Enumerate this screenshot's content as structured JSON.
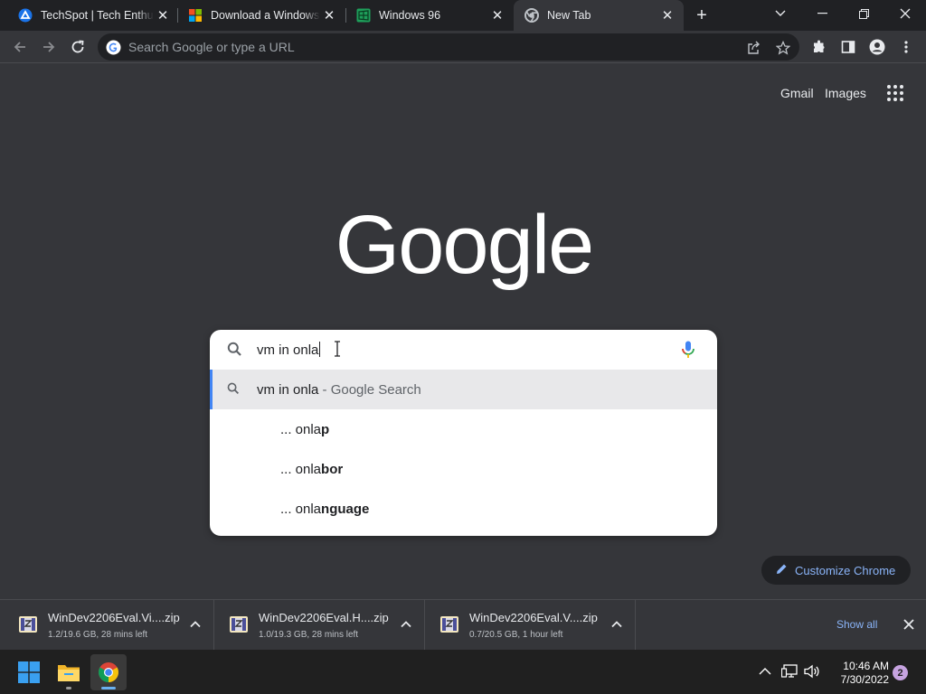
{
  "browser": {
    "tabs": [
      {
        "title": "TechSpot | Tech Enthusiasts, Power Users, Gamers",
        "favicon": "techspot-icon"
      },
      {
        "title": "Download a Windows virtual machine",
        "favicon": "microsoft-icon"
      },
      {
        "title": "Windows 96",
        "favicon": "windows96-icon"
      },
      {
        "title": "New Tab",
        "favicon": "chrome-icon",
        "active": true
      }
    ],
    "omnibox": {
      "placeholder": "Search Google or type a URL"
    }
  },
  "ntp": {
    "links": {
      "gmail": "Gmail",
      "images": "Images"
    },
    "search": {
      "query": "vm in onla",
      "suggestions": [
        {
          "primary": "vm in onla",
          "suffix": " - Google Search",
          "type": "search"
        },
        {
          "prefix": "... onla",
          "completion": "p"
        },
        {
          "prefix": "... onla",
          "completion": "bor"
        },
        {
          "prefix": "... onla",
          "completion": "nguage"
        }
      ]
    },
    "customize_label": "Customize Chrome"
  },
  "downloads": {
    "items": [
      {
        "name": "WinDev2206Eval.Vi....zip",
        "status": "1.2/19.6 GB, 28 mins left"
      },
      {
        "name": "WinDev2206Eval.H....zip",
        "status": "1.0/19.3 GB, 28 mins left"
      },
      {
        "name": "WinDev2206Eval.V....zip",
        "status": "0.7/20.5 GB, 1 hour left"
      }
    ],
    "show_all": "Show all"
  },
  "taskbar": {
    "time": "10:46 AM",
    "date": "7/30/2022",
    "notification_count": "2"
  },
  "colors": {
    "accent_link": "#8ab4f8",
    "frame": "#202124",
    "toolbar": "#35363a"
  }
}
